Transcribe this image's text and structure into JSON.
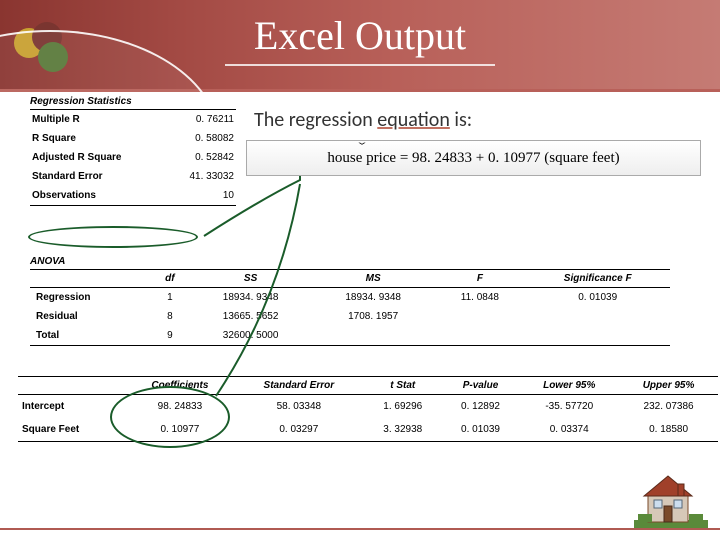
{
  "title": "Excel Output",
  "regression_caption_prefix": "The regression ",
  "regression_caption_underlined": "equation",
  "regression_caption_suffix": " is:",
  "equation": "house price = 98. 24833 + 0. 10977 (square feet)",
  "stats_title": "Regression Statistics",
  "stats": {
    "rows": [
      {
        "label": "Multiple R",
        "value": "0. 76211"
      },
      {
        "label": "R Square",
        "value": "0. 58082"
      },
      {
        "label": "Adjusted R Square",
        "value": "0. 52842"
      },
      {
        "label": "Standard Error",
        "value": "41. 33032"
      },
      {
        "label": "Observations",
        "value": "10"
      }
    ]
  },
  "anova_title": "ANOVA",
  "anova": {
    "headers": [
      "",
      "df",
      "SS",
      "MS",
      "F",
      "Significance F"
    ],
    "rows": [
      {
        "label": "Regression",
        "df": "1",
        "ss": "18934. 9348",
        "ms": "18934. 9348",
        "f": "11. 0848",
        "sigf": "0. 01039"
      },
      {
        "label": "Residual",
        "df": "8",
        "ss": "13665. 5652",
        "ms": "1708. 1957",
        "f": "",
        "sigf": ""
      },
      {
        "label": "Total",
        "df": "9",
        "ss": "32600. 5000",
        "ms": "",
        "f": "",
        "sigf": ""
      }
    ]
  },
  "coef": {
    "headers": [
      "",
      "Coefficients",
      "Standard Error",
      "t Stat",
      "P-value",
      "Lower 95%",
      "Upper 95%"
    ],
    "rows": [
      {
        "label": "Intercept",
        "coef": "98. 24833",
        "se": "58. 03348",
        "t": "1. 69296",
        "p": "0. 12892",
        "lo": "-35. 57720",
        "hi": "232. 07386"
      },
      {
        "label": "Square Feet",
        "coef": "0. 10977",
        "se": "0. 03297",
        "t": "3. 32938",
        "p": "0. 01039",
        "lo": "0. 03374",
        "hi": "0. 18580"
      }
    ]
  },
  "colors": {
    "accent_green": "#1a5c2a",
    "brand": "#a34a44"
  },
  "chart_data": {
    "type": "table",
    "title": "Excel regression output: house price ~ square feet",
    "regression_statistics": {
      "multiple_r": 0.76211,
      "r_square": 0.58082,
      "adjusted_r_square": 0.52842,
      "standard_error": 41.33032,
      "observations": 10
    },
    "anova": [
      {
        "source": "Regression",
        "df": 1,
        "ss": 18934.9348,
        "ms": 18934.9348,
        "f": 11.0848,
        "significance_f": 0.01039
      },
      {
        "source": "Residual",
        "df": 8,
        "ss": 13665.5652,
        "ms": 1708.1957
      },
      {
        "source": "Total",
        "df": 9,
        "ss": 32600.5
      }
    ],
    "coefficients": [
      {
        "term": "Intercept",
        "coef": 98.24833,
        "std_error": 58.03348,
        "t_stat": 1.69296,
        "p_value": 0.12892,
        "lower_95": -35.5772,
        "upper_95": 232.07386
      },
      {
        "term": "Square Feet",
        "coef": 0.10977,
        "std_error": 0.03297,
        "t_stat": 3.32938,
        "p_value": 0.01039,
        "lower_95": 0.03374,
        "upper_95": 0.1858
      }
    ],
    "equation": "house_price_hat = 98.24833 + 0.10977 * square_feet"
  }
}
